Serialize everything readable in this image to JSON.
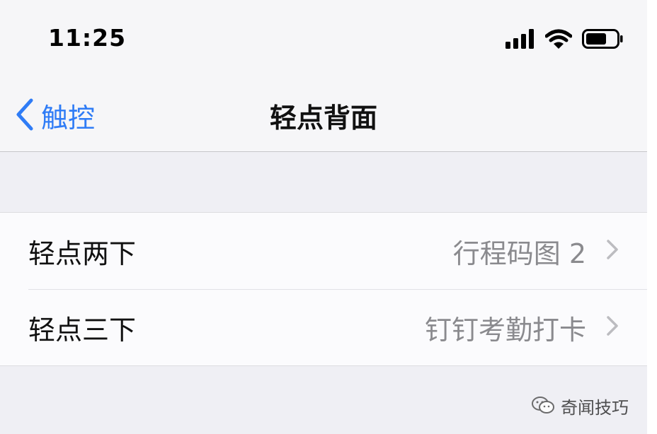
{
  "status_bar": {
    "time": "11:25",
    "icons": [
      "signal-icon",
      "wifi-icon",
      "battery-icon"
    ]
  },
  "nav": {
    "back_label": "触控",
    "title": "轻点背面"
  },
  "rows": [
    {
      "label": "轻点两下",
      "value": "行程码图 2"
    },
    {
      "label": "轻点三下",
      "value": "钉钉考勤打卡"
    }
  ],
  "watermark": {
    "text": "奇闻技巧"
  },
  "colors": {
    "accent": "#2f7cf6",
    "secondary_text": "#8a8a8e",
    "background": "#efeff4"
  }
}
